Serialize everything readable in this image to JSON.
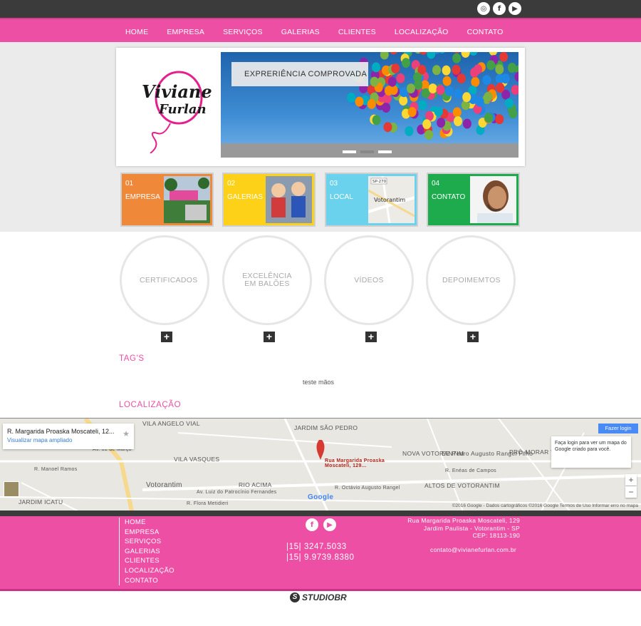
{
  "colors": {
    "accent": "#ec4fa4",
    "dark": "#3b3b3b"
  },
  "top_social": [
    {
      "name": "globe-icon",
      "glyph": "◎"
    },
    {
      "name": "facebook-icon",
      "glyph": "f"
    },
    {
      "name": "youtube-icon",
      "glyph": "▶"
    }
  ],
  "nav": {
    "items": [
      "HOME",
      "EMPRESA",
      "SERVIÇOS",
      "GALERIAS",
      "CLIENTES",
      "LOCALIZAÇÃO",
      "CONTATO"
    ]
  },
  "logo": {
    "line1": "Viviane",
    "line2": "Furlan"
  },
  "slider": {
    "caption": "EXPRERIÊNCIA COMPROVADA",
    "active_dot": 1,
    "dot_count": 3
  },
  "tiles": [
    {
      "num": "01",
      "label": "EMPRESA",
      "color": "#f0883a",
      "pic": "empresa-photo"
    },
    {
      "num": "02",
      "label": "GALERIAS",
      "color": "#fcd117",
      "pic": "galerias-photo"
    },
    {
      "num": "03",
      "label": "LOCAL",
      "color": "#6ad2ec",
      "pic": "local-map",
      "map_label": "Votorantim",
      "road": "SP-270"
    },
    {
      "num": "04",
      "label": "CONTATO",
      "color": "#1dab4e",
      "pic": "contato-photo"
    }
  ],
  "circles": [
    {
      "label": "CERTIFICADOS"
    },
    {
      "label": "EXCELÊNCIA EM BALÕES"
    },
    {
      "label": "VÍDEOS"
    },
    {
      "label": "DEPOIMEMTOS"
    }
  ],
  "plus_label": "+",
  "tags": {
    "title": "TAG'S",
    "text": "teste mãos"
  },
  "location": {
    "title": "LOCALIZAÇÃO",
    "card_address": "R. Margarida Proaska Moscateli, 12...",
    "card_link": "Visualizar mapa ampliado",
    "marker_label": "Rua Margarida Proaska Moscateli, 129...",
    "login_button": "Fazer login",
    "login_tip": "Faça login para ver um mapa do Google criado para você.",
    "places": [
      "VILA ANGELO VIAL",
      "JARDIM SÃO PEDRO",
      "VILA VASQUES",
      "NOVA VOTORANTIM",
      "EE Pedro Augusto Rangel Filho",
      "PRÓ-MORAR VOTORANTIM",
      "Votorantim",
      "RIO ACIMA",
      "ALTOS DE VOTORANTIM",
      "JARDIM ICATU",
      "R. Manoel Ramos",
      "Av. Luiz do Patrocínio Fernandes",
      "R. Flora Metidieri",
      "R. Enéas de Campos",
      "R. Octávio Augusto Rangel",
      "Av. 31 de Março"
    ],
    "footer": "©2016 Google - Dados cartográficos ©2016 Google   Termos de Uso   Informar erro no mapa",
    "google_logo": "Google",
    "zoom_in": "+",
    "zoom_out": "−"
  },
  "footer": {
    "menu": [
      "HOME",
      "EMPRESA",
      "SERVIÇOS",
      "GALERIAS",
      "CLIENTES",
      "LOCALIZAÇÃO",
      "CONTATO"
    ],
    "phone1": "|15| 3247.5033",
    "phone2": "|15| 9.9739.8380",
    "address1": "Rua Margarida Proaska Moscateli, 129",
    "address2": "Jardim Paulista - Votorantim - SP",
    "address3": "CEP: 18113-190",
    "email": "contato@vivianefurlan.com.br",
    "social": [
      {
        "name": "facebook-icon",
        "glyph": "f"
      },
      {
        "name": "youtube-icon",
        "glyph": "▶"
      }
    ]
  },
  "credit": "STUDIOBR"
}
